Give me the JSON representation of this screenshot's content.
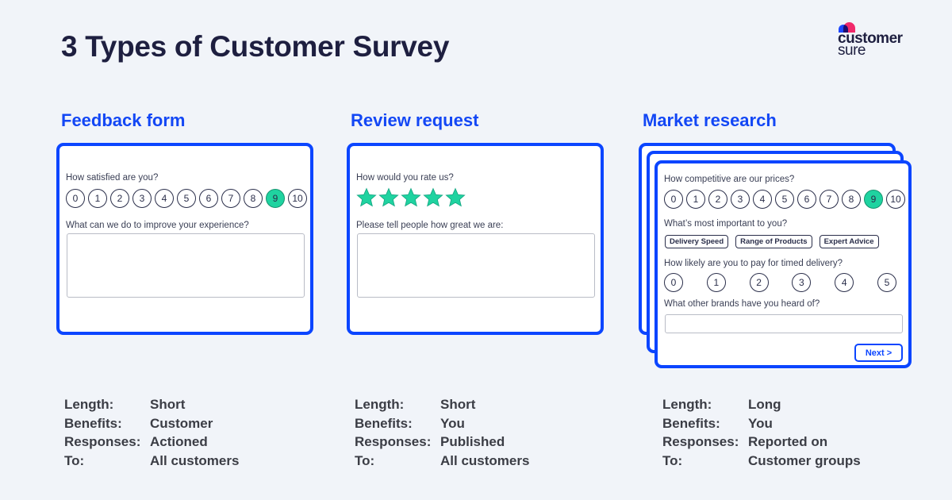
{
  "title": "3 Types of Customer Survey",
  "logo": {
    "line1": "customer",
    "line2": "sure",
    "colors": {
      "blue": "#1d47ff",
      "pink": "#ff2b6e"
    }
  },
  "colors": {
    "accent": "#0b45ff",
    "selected": "#1fd3a0",
    "text": "#1e1f40"
  },
  "sections": [
    {
      "heading": "Feedback form",
      "form": {
        "q1": "How satisfied are you?",
        "scale": [
          "0",
          "1",
          "2",
          "3",
          "4",
          "5",
          "6",
          "7",
          "8",
          "9",
          "10"
        ],
        "selected": "9",
        "q2": "What can we do to improve your experience?",
        "answer": ""
      },
      "info": [
        {
          "label": "Length:",
          "value": "Short"
        },
        {
          "label": "Benefits:",
          "value": "Customer"
        },
        {
          "label": "Responses:",
          "value": "Actioned"
        },
        {
          "label": "To:",
          "value": "All customers"
        }
      ]
    },
    {
      "heading": "Review request",
      "form": {
        "q1": "How would you rate us?",
        "rating": 5,
        "rating_max": 5,
        "q2": "Please tell people how great we are:",
        "answer": ""
      },
      "info": [
        {
          "label": "Length:",
          "value": "Short"
        },
        {
          "label": "Benefits:",
          "value": "You"
        },
        {
          "label": "Responses:",
          "value": "Published"
        },
        {
          "label": "To:",
          "value": "All customers"
        }
      ]
    },
    {
      "heading": "Market research",
      "form": {
        "q1": "How competitive are our prices?",
        "scale": [
          "0",
          "1",
          "2",
          "3",
          "4",
          "5",
          "6",
          "7",
          "8",
          "9",
          "10"
        ],
        "selected": "9",
        "q2": "What’s most important to you?",
        "chips": [
          "Delivery Speed",
          "Range of Products",
          "Expert Advice"
        ],
        "q3": "How likely are you to pay for timed delivery?",
        "scale6": [
          "0",
          "1",
          "2",
          "3",
          "4",
          "5"
        ],
        "q4": "What other brands have you heard of?",
        "answer": "",
        "next_label": "Next >"
      },
      "info": [
        {
          "label": "Length:",
          "value": "Long"
        },
        {
          "label": "Benefits:",
          "value": "You"
        },
        {
          "label": "Responses:",
          "value": "Reported on"
        },
        {
          "label": "To:",
          "value": "Customer groups"
        }
      ]
    }
  ]
}
